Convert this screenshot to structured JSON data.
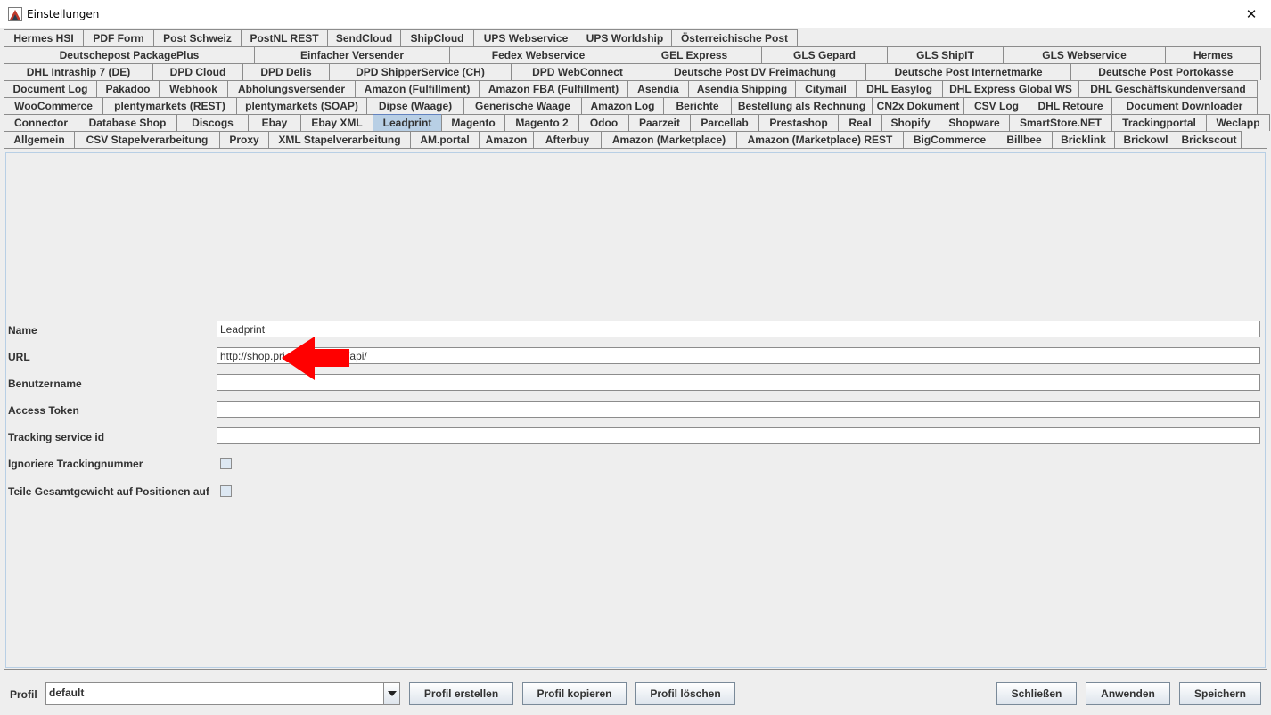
{
  "window": {
    "title": "Einstellungen",
    "close_symbol": "✕"
  },
  "tabs": {
    "rows": [
      [
        {
          "label": "Hermes HSI",
          "w": 90
        },
        {
          "label": "PDF Form",
          "w": 80
        },
        {
          "label": "Post Schweiz",
          "w": 99
        },
        {
          "label": "PostNL REST",
          "w": 98
        },
        {
          "label": "SendCloud",
          "w": 83
        },
        {
          "label": "ShipCloud",
          "w": 83
        },
        {
          "label": "UPS Webservice",
          "w": 118
        },
        {
          "label": "UPS Worldship",
          "w": 106
        },
        {
          "label": "Österreichische Post",
          "w": 142
        }
      ],
      [
        {
          "label": "Deutschepost PackagePlus",
          "w": 282
        },
        {
          "label": "Einfacher Versender",
          "w": 220
        },
        {
          "label": "Fedex Webservice",
          "w": 200
        },
        {
          "label": "GEL Express",
          "w": 152
        },
        {
          "label": "GLS Gepard",
          "w": 142
        },
        {
          "label": "GLS ShipIT",
          "w": 131
        },
        {
          "label": "GLS Webservice",
          "w": 183
        },
        {
          "label": "Hermes",
          "w": 108
        }
      ],
      [
        {
          "label": "DHL Intraship 7 (DE)",
          "w": 168
        },
        {
          "label": "DPD Cloud",
          "w": 102
        },
        {
          "label": "DPD Delis",
          "w": 98
        },
        {
          "label": "DPD ShipperService (CH)",
          "w": 205
        },
        {
          "label": "DPD WebConnect",
          "w": 150
        },
        {
          "label": "Deutsche Post DV Freimachung",
          "w": 250
        },
        {
          "label": "Deutsche Post Internetmarke",
          "w": 231
        },
        {
          "label": "Deutsche Post Portokasse",
          "w": 214
        }
      ],
      [
        {
          "label": "Document Log",
          "w": 105
        },
        {
          "label": "Pakadoo",
          "w": 71
        },
        {
          "label": "Webhook",
          "w": 78
        },
        {
          "label": "Abholungsversender",
          "w": 144
        },
        {
          "label": "Amazon (Fulfillment)",
          "w": 140
        },
        {
          "label": "Amazon FBA (Fulfillment)",
          "w": 168
        },
        {
          "label": "Asendia",
          "w": 69
        },
        {
          "label": "Asendia Shipping",
          "w": 121
        },
        {
          "label": "Citymail",
          "w": 69
        },
        {
          "label": "DHL Easylog",
          "w": 98
        },
        {
          "label": "DHL Express Global WS",
          "w": 154
        },
        {
          "label": "DHL Geschäftskundenversand",
          "w": 201
        }
      ],
      [
        {
          "label": "WooCommerce",
          "w": 112
        },
        {
          "label": "plentymarkets (REST)",
          "w": 151
        },
        {
          "label": "plentymarkets (SOAP)",
          "w": 147
        },
        {
          "label": "Dipse (Waage)",
          "w": 110
        },
        {
          "label": "Generische Waage",
          "w": 133
        },
        {
          "label": "Amazon Log",
          "w": 93
        },
        {
          "label": "Berichte",
          "w": 77
        },
        {
          "label": "Bestellung als Rechnung",
          "w": 159
        },
        {
          "label": "CN2x Dokument",
          "w": 104
        },
        {
          "label": "CSV Log",
          "w": 74
        },
        {
          "label": "DHL Retoure",
          "w": 94
        },
        {
          "label": "Document Downloader",
          "w": 164
        }
      ],
      [
        {
          "label": "Connector",
          "w": 84
        },
        {
          "label": "Database Shop",
          "w": 112
        },
        {
          "label": "Discogs",
          "w": 81
        },
        {
          "label": "Ebay",
          "w": 60
        },
        {
          "label": "Ebay XML",
          "w": 82
        },
        {
          "label": "Leadprint",
          "w": 78,
          "selected": true
        },
        {
          "label": "Magento",
          "w": 72
        },
        {
          "label": "Magento 2",
          "w": 84
        },
        {
          "label": "Odoo",
          "w": 57
        },
        {
          "label": "Paarzeit",
          "w": 70
        },
        {
          "label": "Parcellab",
          "w": 78
        },
        {
          "label": "Prestashop",
          "w": 90
        },
        {
          "label": "Real",
          "w": 50
        },
        {
          "label": "Shopify",
          "w": 65
        },
        {
          "label": "Shopware",
          "w": 80
        },
        {
          "label": "SmartStore.NET",
          "w": 116
        },
        {
          "label": "Trackingportal",
          "w": 107
        },
        {
          "label": "Weclapp",
          "w": 72
        }
      ],
      [
        {
          "label": "Allgemein",
          "w": 80
        },
        {
          "label": "CSV Stapelverarbeitung",
          "w": 164
        },
        {
          "label": "Proxy",
          "w": 56
        },
        {
          "label": "XML Stapelverarbeitung",
          "w": 160
        },
        {
          "label": "AM.portal",
          "w": 78
        },
        {
          "label": "Amazon",
          "w": 62
        },
        {
          "label": "Afterbuy",
          "w": 77
        },
        {
          "label": "Amazon (Marketplace)",
          "w": 153
        },
        {
          "label": "Amazon (Marketplace) REST",
          "w": 188
        },
        {
          "label": "BigCommerce",
          "w": 105
        },
        {
          "label": "Billbee",
          "w": 64
        },
        {
          "label": "Bricklink",
          "w": 71
        },
        {
          "label": "Brickowl",
          "w": 71
        },
        {
          "label": "Brickscout",
          "w": 73
        }
      ]
    ]
  },
  "form": {
    "name_label": "Name",
    "name_value": "Leadprint",
    "url_label": "URL",
    "url_value": "http://shop.pri                    l/api/",
    "user_label": "Benutzername",
    "user_value": "",
    "token_label": "Access Token",
    "token_value": "",
    "tracking_label": "Tracking service id",
    "tracking_value": "",
    "ignore_label": "Ignoriere Trackingnummer",
    "ignore_checked": false,
    "split_label": "Teile Gesamtgewicht auf Positionen auf",
    "split_checked": false
  },
  "bottom": {
    "profile_label": "Profil",
    "profile_value": "default",
    "create_label": "Profil erstellen",
    "copy_label": "Profil kopieren",
    "delete_label": "Profil löschen",
    "close_label": "Schließen",
    "apply_label": "Anwenden",
    "save_label": "Speichern"
  },
  "colors": {
    "selected_tab": "#b8cfe5",
    "arrow": "#ff0000",
    "border": "#8c8c8c"
  }
}
